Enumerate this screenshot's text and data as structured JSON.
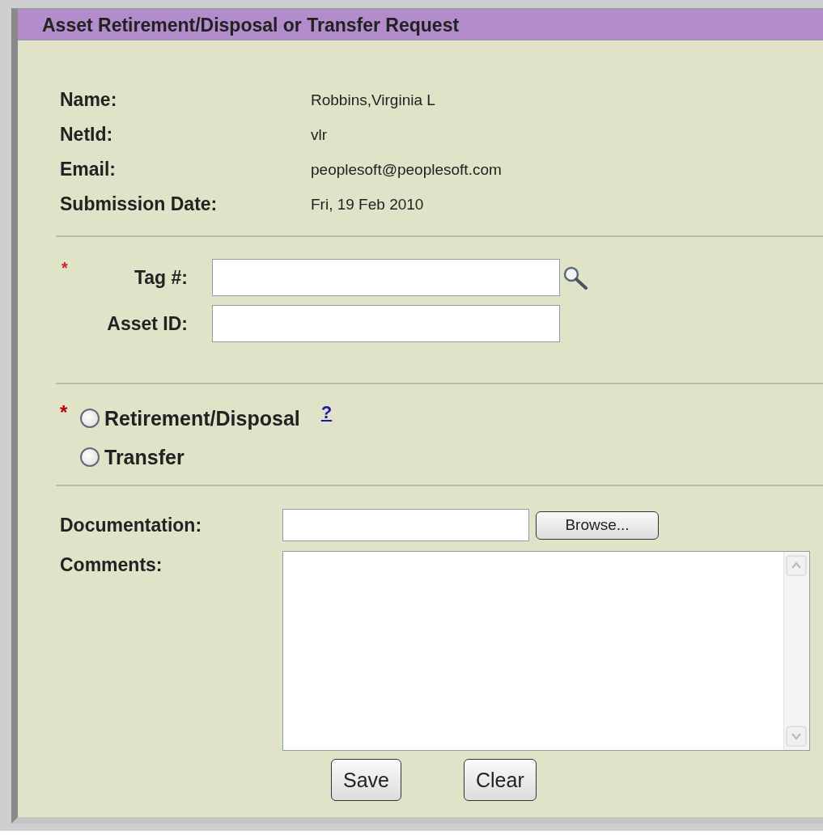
{
  "title": "Asset Retirement/Disposal or Transfer Request",
  "info": [
    {
      "label": "Name:",
      "value": "Robbins,Virginia L"
    },
    {
      "label": "NetId:",
      "value": "vlr"
    },
    {
      "label": "Email:",
      "value": "peoplesoft@peoplesoft.com"
    },
    {
      "label": "Submission Date:",
      "value": "Fri, 19 Feb 2010"
    }
  ],
  "fields": [
    {
      "label": "Tag #:",
      "required_mark": "*",
      "lookup": true
    },
    {
      "label": "Asset ID:",
      "lookup": false
    }
  ],
  "request_type": {
    "required_mark": "*",
    "help_link": "?",
    "options": [
      {
        "label": "Retirement/Disposal",
        "selected": false
      },
      {
        "label": "Transfer",
        "selected": false
      }
    ]
  },
  "documentation": {
    "label": "Documentation:",
    "button": "Browse..."
  },
  "comments": {
    "label": "Comments:"
  },
  "buttons": [
    "Save",
    "Clear"
  ]
}
